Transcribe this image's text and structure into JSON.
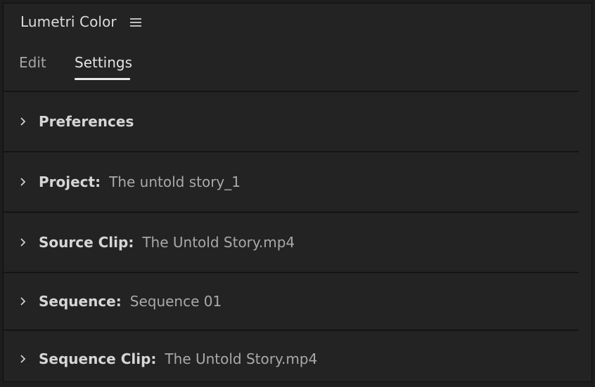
{
  "panel": {
    "title": "Lumetri Color",
    "menu_icon": "hamburger-menu-icon"
  },
  "tabs": [
    {
      "label": "Edit",
      "active": false
    },
    {
      "label": "Settings",
      "active": true
    }
  ],
  "sections": [
    {
      "label": "Preferences",
      "value": "",
      "icon": "chevron-right-icon"
    },
    {
      "label": "Project:",
      "value": "The untold story_1",
      "icon": "chevron-right-icon"
    },
    {
      "label": "Source Clip:",
      "value": "The Untold Story.mp4",
      "icon": "chevron-right-icon"
    },
    {
      "label": "Sequence:",
      "value": "Sequence 01",
      "icon": "chevron-right-icon"
    },
    {
      "label": "Sequence Clip:",
      "value": "The Untold Story.mp4",
      "icon": "chevron-right-icon"
    }
  ],
  "colors": {
    "panel_background": "#232323",
    "divider": "#141414",
    "label_text": "#d6d6d6",
    "value_text": "#a9a9a9",
    "active_tab_underline": "#e8e8e8"
  }
}
